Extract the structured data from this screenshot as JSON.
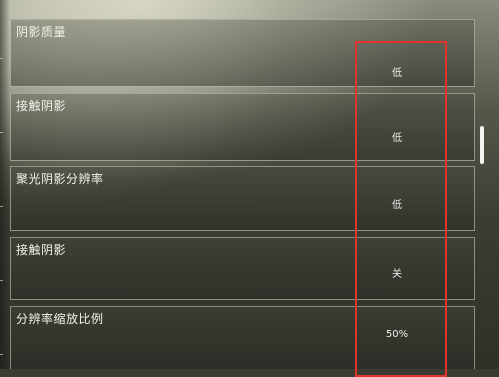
{
  "settings": {
    "rows": [
      {
        "label": "阴影质量",
        "value": "低"
      },
      {
        "label": "接触阴影",
        "value": "低"
      },
      {
        "label": "聚光阴影分辨率",
        "value": "低"
      },
      {
        "label": "接触阴影",
        "value": "关"
      },
      {
        "label": "分辨率缩放比例",
        "value": "50%"
      }
    ]
  },
  "colors": {
    "highlight": "#e0332c",
    "text": "#f2f2ea"
  }
}
